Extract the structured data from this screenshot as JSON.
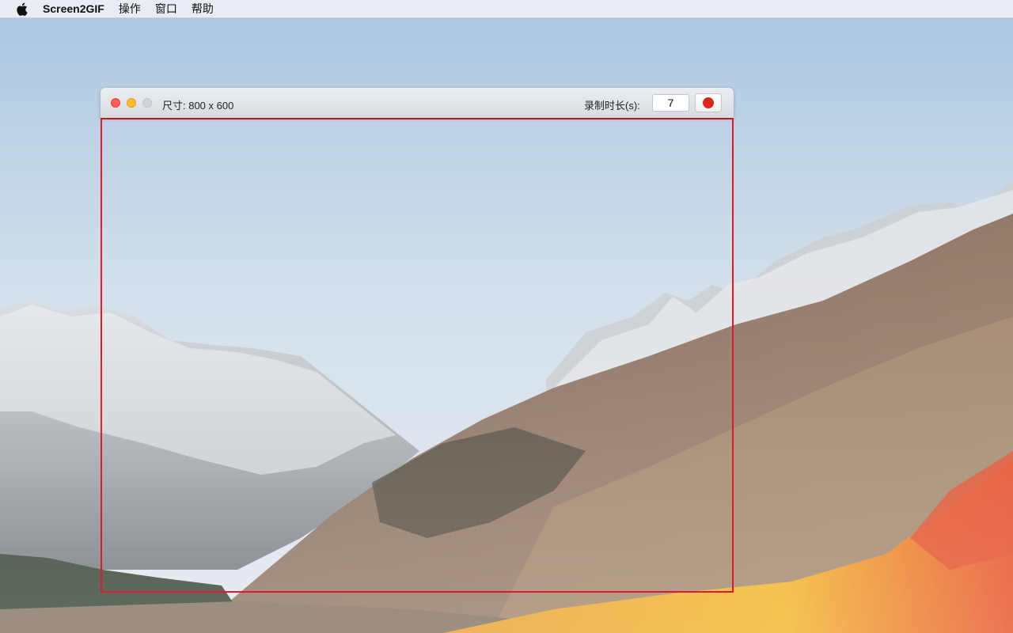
{
  "menubar": {
    "apple_icon": "apple-icon",
    "app_name": "Screen2GIF",
    "items": [
      "操作",
      "窗口",
      "帮助"
    ]
  },
  "recorder": {
    "size_label": "尺寸: 800 x 600",
    "duration_label": "录制时长(s):",
    "duration_value": "7",
    "record_icon": "record-dot-icon"
  },
  "colors": {
    "frame_border": "#e0192e",
    "record_dot": "#d9271f"
  }
}
